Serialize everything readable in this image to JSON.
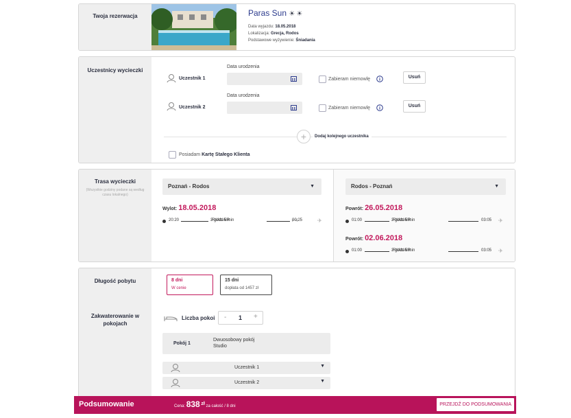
{
  "reservation": {
    "label": "Twoja rezerwacja",
    "hotel_name": "Paras Sun",
    "stars_icon": "sun-icon",
    "departure_label": "Data wyjazdu:",
    "departure_value": "18.05.2018",
    "location_label": "Lokalizacja:",
    "location_value": "Grecja, Rodos",
    "board_label": "Podstawowe wyżywienie:",
    "board_value": "Śniadania"
  },
  "participants": {
    "label": "Uczestnicy wycieczki",
    "dob_label": "Data urodzenia",
    "infant_label": "Zabieram niemowlę",
    "remove_label": "Usuń",
    "items": [
      {
        "name": "Uczestnik 1"
      },
      {
        "name": "Uczestnik 2"
      }
    ],
    "add_label": "Dodaj kolejnego uczestnika",
    "loyalty_prefix": "Posiadam",
    "loyalty_bold": "Kartę Stałego Klienta"
  },
  "route": {
    "label": "Trasa wycieczki",
    "note": "(Wszystkie godziny podane są według czasu lokalnego)",
    "outbound": {
      "select": "Poznań - Rodos",
      "date_label": "Wylot:",
      "date": "18.05.2018",
      "dep_time": "20:20",
      "duration": "3 godz 5 min",
      "airline": "RYANAIR",
      "arr_time": "00:25",
      "arr_suffix": "(+ 1)"
    },
    "return": {
      "select": "Rodos - Poznań",
      "date_label": "Powrót:",
      "options": [
        {
          "date": "26.05.2018",
          "dep_time": "01:00",
          "duration": "3 godz 5 min",
          "airline": "RYANAIR",
          "arr_time": "03:05"
        },
        {
          "date": "02.06.2018",
          "dep_time": "01:00",
          "duration": "3 godz 5 min",
          "airline": "RYANAIR",
          "arr_time": "03:05"
        }
      ]
    }
  },
  "stay": {
    "label": "Długość pobytu",
    "options": [
      {
        "days": "8 dni",
        "price": "W cenie"
      },
      {
        "days": "15 dni",
        "price": "dopłata od 1457 zł"
      }
    ]
  },
  "rooms": {
    "label": "Zakwaterowanie w pokojach",
    "count_label": "Liczba pokoi",
    "minus": "-",
    "count": "1",
    "plus": "+",
    "room_label": "Pokój 1",
    "room_type_line1": "Dwuosobowy pokój",
    "room_type_line2": "Studio",
    "participants": [
      "Uczestnik 1",
      "Uczestnik 2"
    ]
  },
  "summary_bar": {
    "title": "Podsumowanie",
    "price_prefix": "Cena:",
    "price": "838",
    "currency": "zł",
    "price_suffix": "za całość / 8 dni",
    "cta": "PRZEJDŹ DO PODSUMOWANIA"
  },
  "colors": {
    "accent": "#c2185b",
    "bar": "#b8135a",
    "label_bg": "#efefef"
  }
}
